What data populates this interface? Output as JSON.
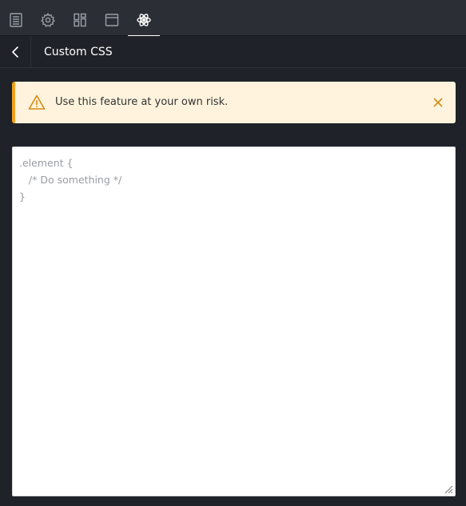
{
  "tabs": [
    {
      "icon": "page-icon",
      "active": false
    },
    {
      "icon": "gear-icon",
      "active": false
    },
    {
      "icon": "layout-icon",
      "active": false
    },
    {
      "icon": "window-icon",
      "active": false
    },
    {
      "icon": "atom-icon",
      "active": true
    }
  ],
  "header": {
    "back_icon": "chevron-left-icon",
    "title": "Custom CSS"
  },
  "alert": {
    "icon": "warning-icon",
    "message": "Use this feature at your own risk.",
    "close_icon": "close-icon",
    "accent": "#f0a020"
  },
  "editor": {
    "placeholder_lines": [
      ".element {",
      "   /* Do something */",
      "}"
    ]
  }
}
